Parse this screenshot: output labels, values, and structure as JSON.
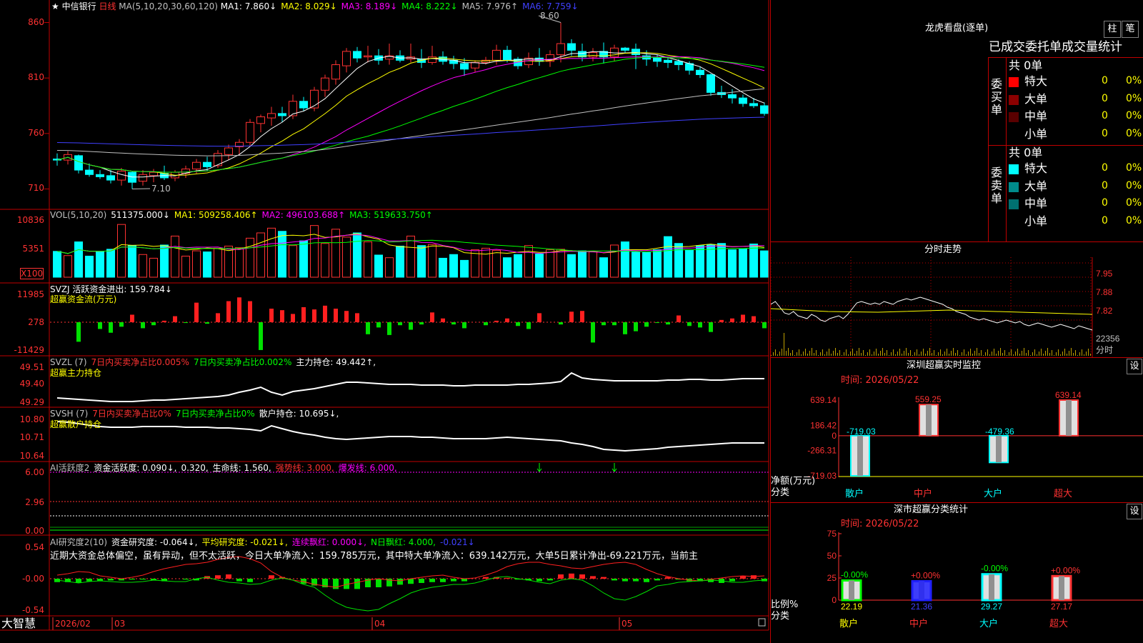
{
  "title_bar": {
    "star": "★",
    "stock_name": "中信银行",
    "period": "日线",
    "ma_label": "MA(5,10,20,30,60,120)",
    "items": [
      {
        "text": "MA1: 7.860↓",
        "color": "#ffffff"
      },
      {
        "text": "MA2: 8.029↓",
        "color": "#ffff00"
      },
      {
        "text": "MA3: 8.189↓",
        "color": "#ff00ff"
      },
      {
        "text": "MA4: 8.222↓",
        "color": "#00ff00"
      },
      {
        "text": "MA5: 7.976↑",
        "color": "#c0c0c0"
      },
      {
        "text": "MA6: 7.759↓",
        "color": "#4040ff"
      }
    ]
  },
  "price_panel": {
    "ticks": [
      "860",
      "810",
      "760",
      "710"
    ],
    "high_marker": "8.60",
    "low_marker": "7.10"
  },
  "vol_panel": {
    "header": [
      {
        "text": "VOL(5,10,20)",
        "color": "#c0c0c0"
      },
      {
        "text": "511375.000↓",
        "color": "#ffffff"
      },
      {
        "text": "MA1: 509258.406↑",
        "color": "#ffff00"
      },
      {
        "text": "MA2: 496103.688↑",
        "color": "#ff00ff"
      },
      {
        "text": "MA3: 519633.750↑",
        "color": "#00ff00"
      }
    ],
    "ticks": [
      "10836",
      "5351",
      "X100"
    ]
  },
  "svzj_panel": {
    "header": [
      {
        "text": "SVZJ  活跃资金进出: 159.784↓",
        "color": "#ffffff"
      }
    ],
    "subtitle": "超赢资金流(万元)",
    "ticks": [
      "11985",
      "278",
      "-11429"
    ]
  },
  "svzl_panel": {
    "header": [
      {
        "text": "SVZL (7)",
        "color": "#c0c0c0"
      },
      {
        "text": "7日内买卖净占比0.005%",
        "color": "#ff3232"
      },
      {
        "text": "7日内买卖净占比0.002%",
        "color": "#00ff00"
      },
      {
        "text": "主力持仓: 49.442↑,",
        "color": "#ffffff"
      }
    ],
    "subtitle": "超赢主力持仓",
    "ticks": [
      "49.51",
      "49.40",
      "49.29"
    ]
  },
  "svsh_panel": {
    "header": [
      {
        "text": "SVSH (7)",
        "color": "#c0c0c0"
      },
      {
        "text": "7日内买卖净占比0%",
        "color": "#ff3232"
      },
      {
        "text": "7日内买卖净占比0%",
        "color": "#00ff00"
      },
      {
        "text": "散户持仓: 10.695↓,",
        "color": "#ffffff"
      }
    ],
    "subtitle": "超赢散户持仓",
    "ticks": [
      "10.80",
      "10.71",
      "10.64"
    ]
  },
  "ai_active_panel": {
    "header": [
      {
        "text": "AI活跃度2",
        "color": "#c0c0c0"
      },
      {
        "text": "资金活跃度: 0.090↓,",
        "color": "#ffffff"
      },
      {
        "text": "0.320,",
        "color": "#ffffff"
      },
      {
        "text": "生命线: 1.560,",
        "color": "#ffffff"
      },
      {
        "text": "强势线: 3.000,",
        "color": "#ff3232"
      },
      {
        "text": "爆发线: 6.000,",
        "color": "#ff00ff"
      }
    ],
    "ticks": [
      "6.00",
      "2.96",
      "0.00"
    ]
  },
  "ai_research_panel": {
    "header": [
      {
        "text": "AI研究度2(10)",
        "color": "#c0c0c0"
      },
      {
        "text": "资金研究度: -0.064↓,",
        "color": "#ffffff"
      },
      {
        "text": "平均研究度: -0.021↓,",
        "color": "#ffff00"
      },
      {
        "text": "连续飘红: 0.000↓,",
        "color": "#ff00ff"
      },
      {
        "text": "N日飘红: 4.000,",
        "color": "#00ff00"
      },
      {
        "text": "-0.021↓",
        "color": "#4040ff"
      }
    ],
    "comment": "近期大资金总体偏空，虽有异动，但不太活跃，今日大单净流入：159.785万元，其中特大单净流入：639.142万元，大单5日累计净出-69.221万元，当前主",
    "ticks": [
      "0.54",
      "-0.00",
      "-0.54"
    ]
  },
  "date_axis": {
    "logo": "大智慧",
    "labels": [
      "2026/02",
      "03",
      "04",
      "05"
    ]
  },
  "right_top": {
    "title": "龙虎看盘(逐单)",
    "btn1": "柱",
    "btn2": "笔",
    "subtitle": "已成交委托单成交量统计",
    "buy_side": "委买单",
    "sell_side": "委卖单",
    "buy_count": "共 0单",
    "sell_count": "共 0单",
    "buy_rows": [
      {
        "label": "特大",
        "value": "0",
        "pct": "0%",
        "color": "#ff0000"
      },
      {
        "label": "大单",
        "value": "0",
        "pct": "0%",
        "color": "#8b0000"
      },
      {
        "label": "中单",
        "value": "0",
        "pct": "0%",
        "color": "#5a0000"
      },
      {
        "label": "小单",
        "value": "0",
        "pct": "0%",
        "color": ""
      }
    ],
    "sell_rows": [
      {
        "label": "特大",
        "value": "0",
        "pct": "0%",
        "color": "#00ffff"
      },
      {
        "label": "大单",
        "value": "0",
        "pct": "0%",
        "color": "#008b8b"
      },
      {
        "label": "中单",
        "value": "0",
        "pct": "0%",
        "color": "#007070"
      },
      {
        "label": "小单",
        "value": "0",
        "pct": "0%",
        "color": ""
      }
    ]
  },
  "intraday": {
    "title": "分时走势",
    "ticks": [
      "7.95",
      "7.88",
      "7.82"
    ],
    "vol_label": "22356",
    "time_label": "分时"
  },
  "sz_monitor": {
    "title": "深圳超赢实时监控",
    "btn": "设",
    "time": "时间: 2026/05/22",
    "ticks": [
      "639.14",
      "186.42",
      "0",
      "-266.31",
      "-719.03"
    ],
    "unit_label": "净额(万元)",
    "class_label": "分类",
    "bars": [
      {
        "cat": "散户",
        "value": -719.03,
        "label": "-719.03",
        "cat_color": "#00ffff"
      },
      {
        "cat": "中户",
        "value": 559.25,
        "label": "559.25",
        "cat_color": "#ff3232"
      },
      {
        "cat": "大户",
        "value": -479.36,
        "label": "-479.36",
        "cat_color": "#00ffff"
      },
      {
        "cat": "超大",
        "value": 639.14,
        "label": "639.14",
        "cat_color": "#ff3232"
      }
    ]
  },
  "sz_class": {
    "title": "深市超赢分类统计",
    "btn": "设",
    "time": "时间: 2026/05/22",
    "ticks": [
      "75",
      "50",
      "25",
      "0"
    ],
    "ratio_label": "比例%",
    "class_label": "分类",
    "bars": [
      {
        "cat": "散户",
        "value": 22.19,
        "label": "22.19",
        "delta": "-0.00%",
        "color": "#00ff00",
        "delta_color": "#00ff00",
        "cat_color": "#ffff00"
      },
      {
        "cat": "中户",
        "value": 21.36,
        "label": "21.36",
        "delta": "+0.00%",
        "color": "#2020ff",
        "delta_color": "#ff3232",
        "cat_color": "#ff3232"
      },
      {
        "cat": "大户",
        "value": 29.27,
        "label": "29.27",
        "delta": "-0.00%",
        "color": "#00ffff",
        "delta_color": "#00ff00",
        "cat_color": "#00ffff"
      },
      {
        "cat": "超大",
        "value": 27.17,
        "label": "27.17",
        "delta": "+0.00%",
        "color": "#ff3232",
        "delta_color": "#ff3232",
        "cat_color": "#ff3232"
      }
    ]
  },
  "chart_data": {
    "type": "candlestick",
    "title": "中信银行 日线",
    "x_labels": [
      "2026/02",
      "03",
      "04",
      "05"
    ],
    "ylim": [
      7.0,
      8.7
    ],
    "candles": [
      [
        7.37,
        7.42,
        7.31,
        7.36
      ],
      [
        7.36,
        7.44,
        7.32,
        7.41
      ],
      [
        7.4,
        7.41,
        7.24,
        7.27
      ],
      [
        7.27,
        7.33,
        7.21,
        7.23
      ],
      [
        7.23,
        7.27,
        7.19,
        7.21
      ],
      [
        7.22,
        7.27,
        7.15,
        7.18
      ],
      [
        7.18,
        7.29,
        7.13,
        7.26
      ],
      [
        7.25,
        7.26,
        7.1,
        7.16
      ],
      [
        7.17,
        7.27,
        7.13,
        7.23
      ],
      [
        7.22,
        7.28,
        7.16,
        7.25
      ],
      [
        7.24,
        7.31,
        7.18,
        7.2
      ],
      [
        7.2,
        7.27,
        7.17,
        7.25
      ],
      [
        7.24,
        7.31,
        7.2,
        7.28
      ],
      [
        7.28,
        7.37,
        7.24,
        7.34
      ],
      [
        7.34,
        7.39,
        7.26,
        7.3
      ],
      [
        7.31,
        7.45,
        7.29,
        7.42
      ],
      [
        7.41,
        7.5,
        7.36,
        7.47
      ],
      [
        7.48,
        7.55,
        7.41,
        7.52
      ],
      [
        7.52,
        7.73,
        7.49,
        7.7
      ],
      [
        7.69,
        7.77,
        7.61,
        7.75
      ],
      [
        7.74,
        7.84,
        7.67,
        7.78
      ],
      [
        7.78,
        7.84,
        7.7,
        7.76
      ],
      [
        7.76,
        7.95,
        7.73,
        7.89
      ],
      [
        7.89,
        7.93,
        7.8,
        7.83
      ],
      [
        7.83,
        8.02,
        7.8,
        7.99
      ],
      [
        7.99,
        8.13,
        7.93,
        8.1
      ],
      [
        8.09,
        8.26,
        8.04,
        8.22
      ],
      [
        8.21,
        8.37,
        8.15,
        8.34
      ],
      [
        8.34,
        8.38,
        8.24,
        8.28
      ],
      [
        8.29,
        8.39,
        8.24,
        8.3
      ],
      [
        8.3,
        8.36,
        8.22,
        8.26
      ],
      [
        8.27,
        8.41,
        8.22,
        8.3
      ],
      [
        8.3,
        8.35,
        8.24,
        8.26
      ],
      [
        8.27,
        8.41,
        8.24,
        8.29
      ],
      [
        8.27,
        8.36,
        8.19,
        8.24
      ],
      [
        8.24,
        8.39,
        8.22,
        8.29
      ],
      [
        8.29,
        8.34,
        8.22,
        8.25
      ],
      [
        8.26,
        8.3,
        8.18,
        8.23
      ],
      [
        8.23,
        8.28,
        8.12,
        8.18
      ],
      [
        8.19,
        8.26,
        8.15,
        8.24
      ],
      [
        8.24,
        8.29,
        8.22,
        8.26
      ],
      [
        8.26,
        8.4,
        8.22,
        8.35
      ],
      [
        8.35,
        8.39,
        8.24,
        8.26
      ],
      [
        8.27,
        8.29,
        8.18,
        8.21
      ],
      [
        8.22,
        8.33,
        8.19,
        8.28
      ],
      [
        8.28,
        8.37,
        8.21,
        8.25
      ],
      [
        8.25,
        8.35,
        8.2,
        8.31
      ],
      [
        8.31,
        8.6,
        8.24,
        8.41
      ],
      [
        8.41,
        8.45,
        8.3,
        8.35
      ],
      [
        8.34,
        8.41,
        8.25,
        8.29
      ],
      [
        8.29,
        8.37,
        8.25,
        8.33
      ],
      [
        8.34,
        8.42,
        8.23,
        8.29
      ],
      [
        8.29,
        8.4,
        8.25,
        8.37
      ],
      [
        8.37,
        8.38,
        8.33,
        8.35
      ],
      [
        8.36,
        8.41,
        8.18,
        8.31
      ],
      [
        8.3,
        8.35,
        8.21,
        8.27
      ],
      [
        8.28,
        8.31,
        8.2,
        8.25
      ],
      [
        8.26,
        8.29,
        8.19,
        8.24
      ],
      [
        8.25,
        8.27,
        8.17,
        8.22
      ],
      [
        8.23,
        8.25,
        8.13,
        8.17
      ],
      [
        8.17,
        8.2,
        8.1,
        8.13
      ],
      [
        8.13,
        8.14,
        7.94,
        7.97
      ],
      [
        7.97,
        8.03,
        7.92,
        7.95
      ],
      [
        7.95,
        8.0,
        7.87,
        7.92
      ],
      [
        7.92,
        7.95,
        7.84,
        7.87
      ],
      [
        7.87,
        7.92,
        7.83,
        7.85
      ],
      [
        7.85,
        7.88,
        7.76,
        7.78
      ]
    ],
    "volumes": [
      4900,
      4100,
      6700,
      4000,
      4900,
      5300,
      10000,
      6000,
      4300,
      3600,
      6100,
      7800,
      4000,
      5000,
      4800,
      5500,
      5900,
      5600,
      7400,
      8400,
      9300,
      8700,
      6000,
      6900,
      9800,
      6400,
      9100,
      7600,
      8400,
      6700,
      4200,
      3700,
      5900,
      7800,
      6000,
      6200,
      3600,
      4300,
      3200,
      5200,
      5500,
      5100,
      3700,
      4300,
      6000,
      4400,
      5200,
      5300,
      4300,
      5000,
      4800,
      3700,
      6100,
      6700,
      4800,
      4700,
      5200,
      7700,
      6400,
      5100,
      6000,
      6200,
      6400,
      5200,
      5400,
      6300,
      5000
    ],
    "flows": [
      0,
      0,
      -2600,
      0,
      -900,
      -1400,
      -600,
      1000,
      -800,
      -400,
      200,
      800,
      -100,
      2600,
      -200,
      1200,
      2800,
      3300,
      2800,
      -3700,
      1800,
      1600,
      1100,
      2000,
      1700,
      2200,
      1800,
      1500,
      1200,
      -1600,
      -700,
      -1700,
      -400,
      -1000,
      -300,
      1300,
      500,
      -300,
      -800,
      0,
      -400,
      200,
      500,
      -500,
      -900,
      1200,
      0,
      -300,
      1400,
      1500,
      -2700,
      -400,
      -400,
      -1600,
      -1200,
      -600,
      -100,
      -300,
      900,
      -500,
      -700,
      -1300,
      300,
      500,
      1000,
      800,
      -800
    ]
  }
}
